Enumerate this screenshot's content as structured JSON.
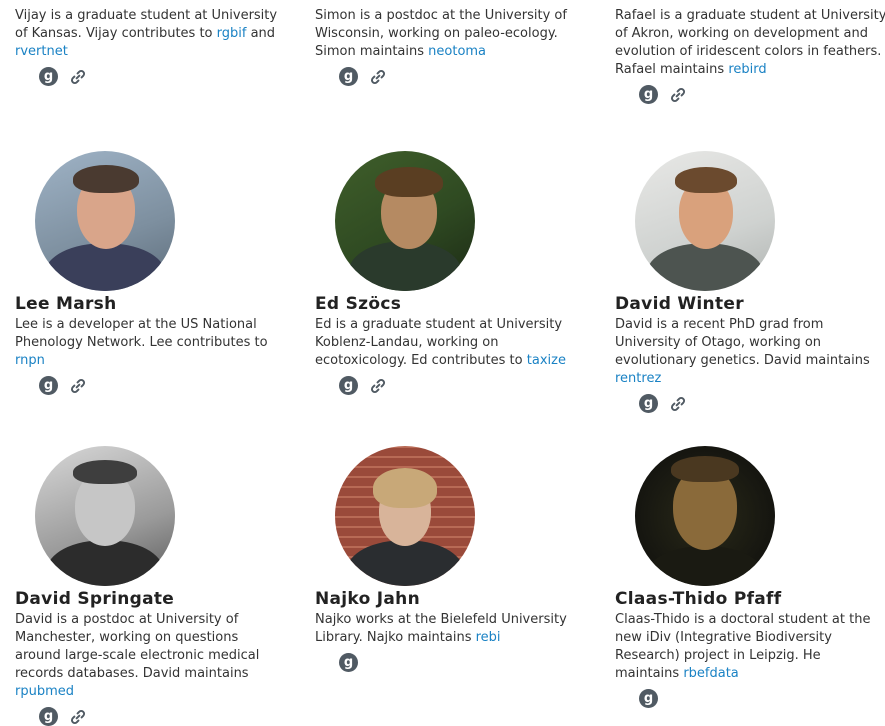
{
  "people": [
    {
      "id": "vijay",
      "bio_pre": "Vijay is a graduate student at University of Kansas. Vijay contributes to ",
      "pkg1": "rgbif",
      "mid": " and ",
      "pkg2": "rvertnet",
      "post": "",
      "github_glyph": "g",
      "link_icon": "link-icon"
    },
    {
      "id": "simon",
      "bio_pre": "Simon is a postdoc at the University of Wisconsin, working on paleo-ecology. Simon maintains ",
      "pkg1": "neotoma",
      "github_glyph": "g",
      "link_icon": "link-icon"
    },
    {
      "id": "rafael",
      "bio_pre": "Rafael is a graduate student at University of Akron, working on development and evolution of iridescent colors in feathers. Rafael maintains ",
      "pkg1": "rebird",
      "github_glyph": "g",
      "link_icon": "link-icon"
    },
    {
      "id": "lee",
      "name": "Lee Marsh",
      "bio_pre": "Lee is a developer at the US National Phenology Network. Lee contributes to ",
      "pkg1": "rnpn",
      "github_glyph": "g",
      "link_icon": "link-icon"
    },
    {
      "id": "ed",
      "name": "Ed Szöcs",
      "bio_pre": "Ed is a graduate student at University Koblenz-Landau, working on ecotoxicology. Ed contributes to ",
      "pkg1": "taxize",
      "github_glyph": "g",
      "link_icon": "link-icon"
    },
    {
      "id": "davidw",
      "name": "David Winter",
      "bio_pre": "David is a recent PhD grad from University of Otago, working on evolutionary genetics. David maintains ",
      "pkg1": "rentrez",
      "github_glyph": "g",
      "link_icon": "link-icon"
    },
    {
      "id": "davids",
      "name": "David Springate",
      "bio_pre": "David is a postdoc at University of Manchester, working on questions around large-scale electronic medical records databases. David maintains ",
      "pkg1": "rpubmed",
      "github_glyph": "g",
      "link_icon": "link-icon"
    },
    {
      "id": "najko",
      "name": "Najko Jahn",
      "bio_pre": "Najko works at the Bielefeld University Library. Najko maintains ",
      "pkg1": "rebi",
      "github_glyph": "g"
    },
    {
      "id": "claas",
      "name": "Claas-Thido Pfaff",
      "bio_pre": "Claas-Thido is a doctoral student at the new iDiv (Integrative Biodiversity Research) project in Leipzig. He maintains ",
      "pkg1": "rbefdata",
      "github_glyph": "g"
    }
  ],
  "colors": {
    "link": "#1a82c4",
    "icon": "#505a63"
  }
}
